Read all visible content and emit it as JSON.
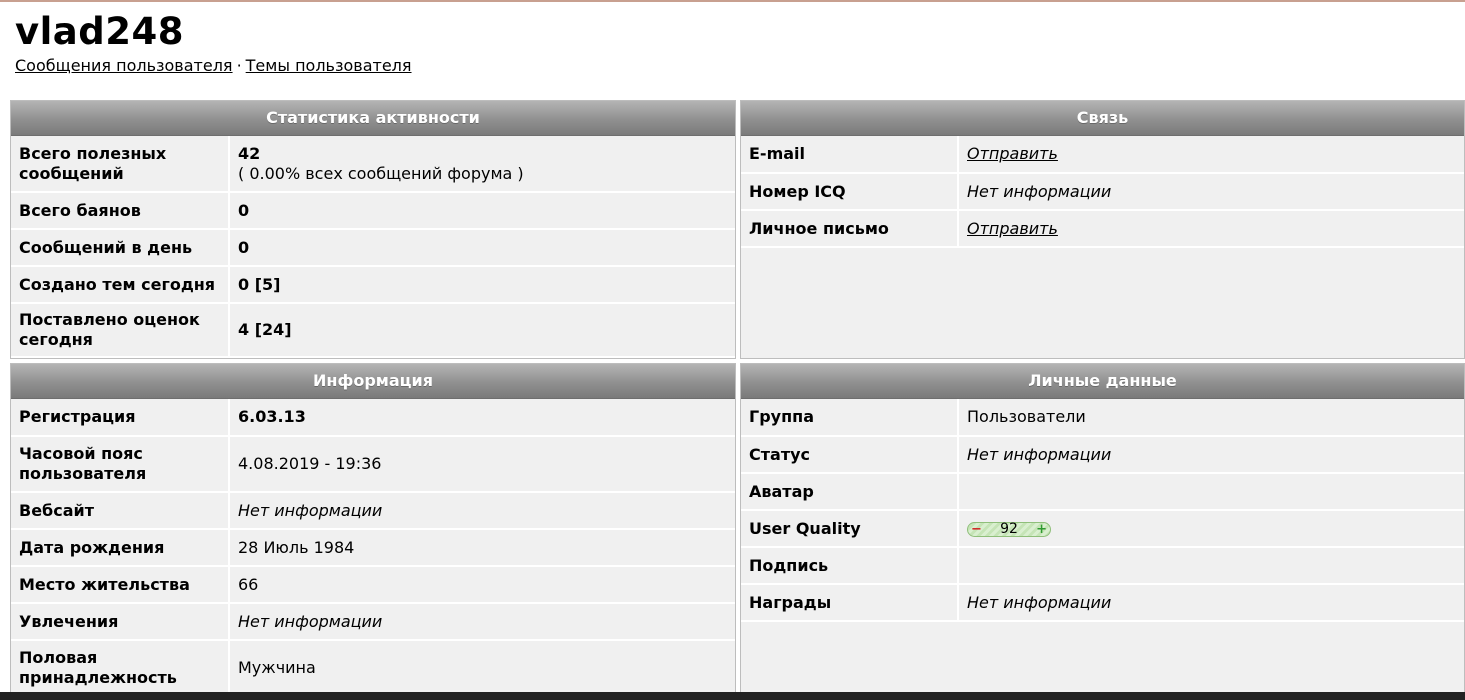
{
  "profile": {
    "username": "vlad248",
    "links": {
      "posts": "Сообщения пользователя",
      "separator": "·",
      "topics": "Темы пользователя"
    }
  },
  "activity": {
    "title": "Статистика активности",
    "rows": [
      {
        "label": "Всего полезных сообщений",
        "value": "42",
        "sub": "( 0.00% всех сообщений форума )"
      },
      {
        "label": "Всего баянов",
        "value": "0"
      },
      {
        "label": "Сообщений в день",
        "value": "0"
      },
      {
        "label": "Создано тем сегодня",
        "value": "0 [5]"
      },
      {
        "label": "Поставлено оценок сегодня",
        "value": "4 [24]"
      }
    ]
  },
  "contact": {
    "title": "Связь",
    "rows": [
      {
        "label": "E-mail",
        "value": "Отправить"
      },
      {
        "label": "Номер ICQ",
        "value": "Нет информации"
      },
      {
        "label": "Личное письмо",
        "value": "Отправить"
      }
    ]
  },
  "info": {
    "title": "Информация",
    "rows": [
      {
        "label": "Регистрация",
        "value": "6.03.13"
      },
      {
        "label": "Часовой пояс пользователя",
        "value": "4.08.2019 - 19:36"
      },
      {
        "label": "Вебсайт",
        "value": "Нет информации"
      },
      {
        "label": "Дата рождения",
        "value": "28 Июль 1984"
      },
      {
        "label": "Место жительства",
        "value": "66"
      },
      {
        "label": "Увлечения",
        "value": "Нет информации"
      },
      {
        "label": "Половая принадлежность",
        "value": "Мужчина"
      }
    ]
  },
  "personal": {
    "title": "Личные данные",
    "rows": [
      {
        "label": "Группа",
        "value": "Пользователи"
      },
      {
        "label": "Статус",
        "value": "Нет информации"
      },
      {
        "label": "Аватар",
        "value": ""
      },
      {
        "label": "User Quality",
        "value": "92",
        "minus": "−",
        "plus": "+"
      },
      {
        "label": "Подпись",
        "value": ""
      },
      {
        "label": "Награды",
        "value": "Нет информации"
      }
    ]
  },
  "colors": {
    "header_top": "#b4b4b4",
    "header_bottom": "#7a7a7a",
    "panel_bg": "#f0f0f0",
    "quality_bar": "#c5e4b6"
  }
}
